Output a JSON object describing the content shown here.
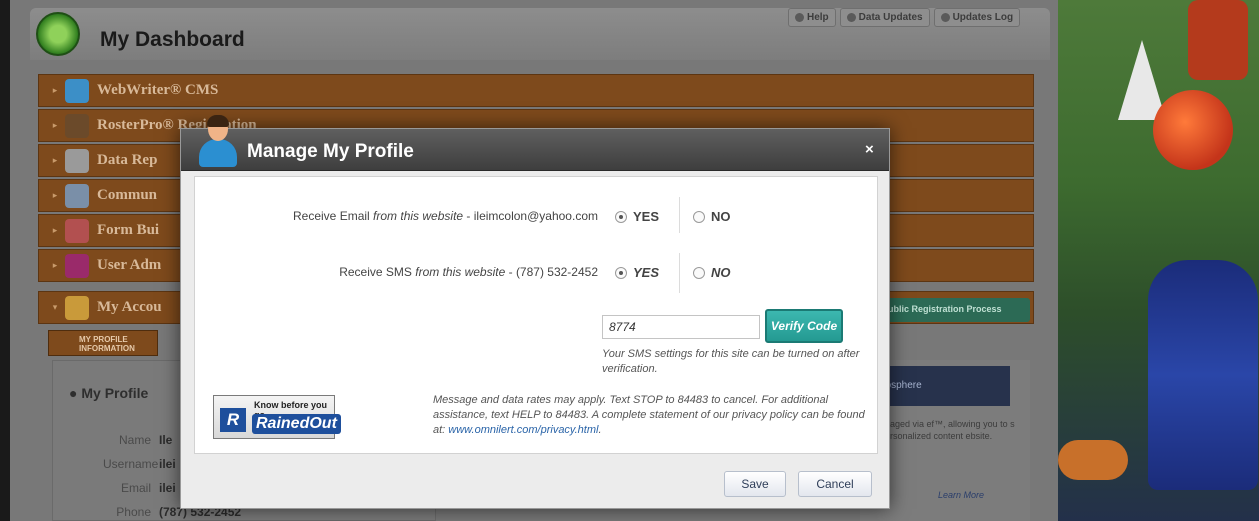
{
  "dashboard": {
    "title": "My Dashboard",
    "toplinks": [
      {
        "label": "Help",
        "icon": "help-icon"
      },
      {
        "label": "Data Updates",
        "icon": "bell-icon"
      },
      {
        "label": "Updates Log",
        "icon": "info-icon"
      }
    ],
    "menu": [
      {
        "label": "WebWriter® CMS",
        "icon": "webwriter-icon"
      },
      {
        "label": "RosterPro® Registration",
        "icon": "stamp-icon"
      },
      {
        "label": "Data Rep",
        "icon": "document-icon"
      },
      {
        "label": "Commun",
        "icon": "megaphone-icon"
      },
      {
        "label": "Form Bui",
        "icon": "form-icon"
      },
      {
        "label": "User Adm",
        "icon": "user-admin-icon"
      },
      {
        "label": "My Accou",
        "icon": "account-icon"
      }
    ],
    "subtab": "MY PROFILE INFORMATION",
    "registration_button": "ublic Registration Process",
    "profile": {
      "title": "My Profile",
      "fields": [
        {
          "label": "Name",
          "value": "Ile"
        },
        {
          "label": "Username",
          "value": "ilei"
        },
        {
          "label": "Email",
          "value": "ilei"
        },
        {
          "label": "Phone",
          "value": "(787) 532-2452"
        }
      ]
    },
    "side": {
      "header": "nosphere",
      "text": "anaged via ef™, allowing you to s personalized content ebsite.",
      "link": "Learn More"
    }
  },
  "modal": {
    "title": "Manage My Profile",
    "close": "×",
    "email_row": {
      "label_prefix": "Receive Email",
      "label_italic": "from this website",
      "label_suffix": "- ileimcolon@yahoo.com",
      "yes": "YES",
      "no": "NO",
      "selected": "YES"
    },
    "sms_row": {
      "label_prefix": "Receive SMS",
      "label_italic": "from this website",
      "label_suffix": "- (787) 532-2452",
      "yes": "YES",
      "no": "NO",
      "selected": "YES"
    },
    "code_value": "8774",
    "verify_label": "Verify Code",
    "verify_note": "Your SMS settings for this site can be turned on after verification.",
    "legal_text": "Message and data rates may apply. Text STOP to 84483 to cancel. For additional assistance, text HELP to 84483. A complete statement of our privacy policy can be found at:",
    "legal_link": "www.omnilert.com/privacy.html",
    "legal_end": ".",
    "logo": {
      "tagline": "Know before you go",
      "brand": "RainedOut",
      "letter": "R"
    },
    "save_label": "Save",
    "cancel_label": "Cancel"
  },
  "colors": {
    "menu_orange": "#7e4a1c",
    "modal_header": "#4a4a4a",
    "verify_teal": "#2aa59d",
    "link_blue": "#2a64a8"
  }
}
